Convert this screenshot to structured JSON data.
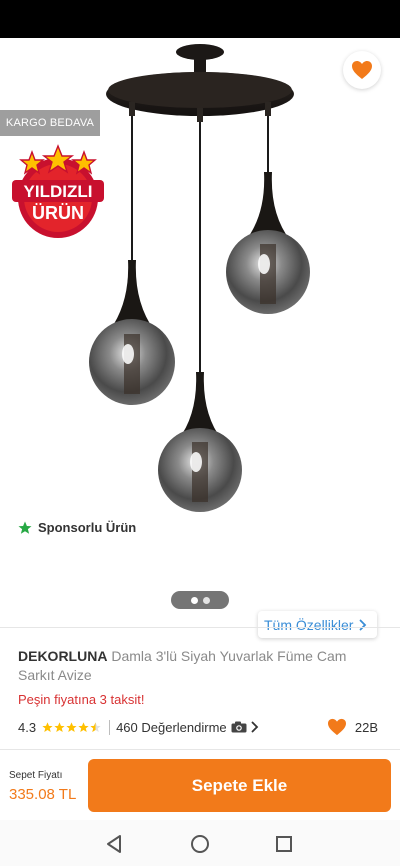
{
  "colors": {
    "accent": "#f27a1a",
    "link": "#3a8dd6",
    "installment": "#d83233",
    "star": "#ffc000",
    "sponsor_star": "#27a844"
  },
  "header": {
    "back_icon": "arrow-left-icon",
    "share_icon": "share-icon",
    "favorite_icon": "heart-icon"
  },
  "gallery": {
    "cargo_badge": "KARGO BEDAVA",
    "star_badge": {
      "line1": "YILDIZLI",
      "line2": "ÜRÜN"
    },
    "sponsor_label": "Sponsorlu Ürün",
    "pager": {
      "total": 2,
      "active": 1
    },
    "all_specs_label": "Tüm Özellikler"
  },
  "product": {
    "brand": "DEKORLUNA",
    "name": "Damla 3'lü Siyah Yuvarlak Füme Cam Sarkıt Avize",
    "installment": "Peşin fiyatına 3 taksit!",
    "rating": "4.3",
    "rating_stars": 4.3,
    "reviews": "460 Değerlendirme",
    "likes": "22B"
  },
  "bottom": {
    "price_label": "Sepet Fiyatı",
    "price": "335.08 TL",
    "add_to_cart": "Sepete Ekle"
  },
  "navbar": {
    "back": "nav-back-icon",
    "home": "nav-home-icon",
    "recents": "nav-recents-icon"
  }
}
